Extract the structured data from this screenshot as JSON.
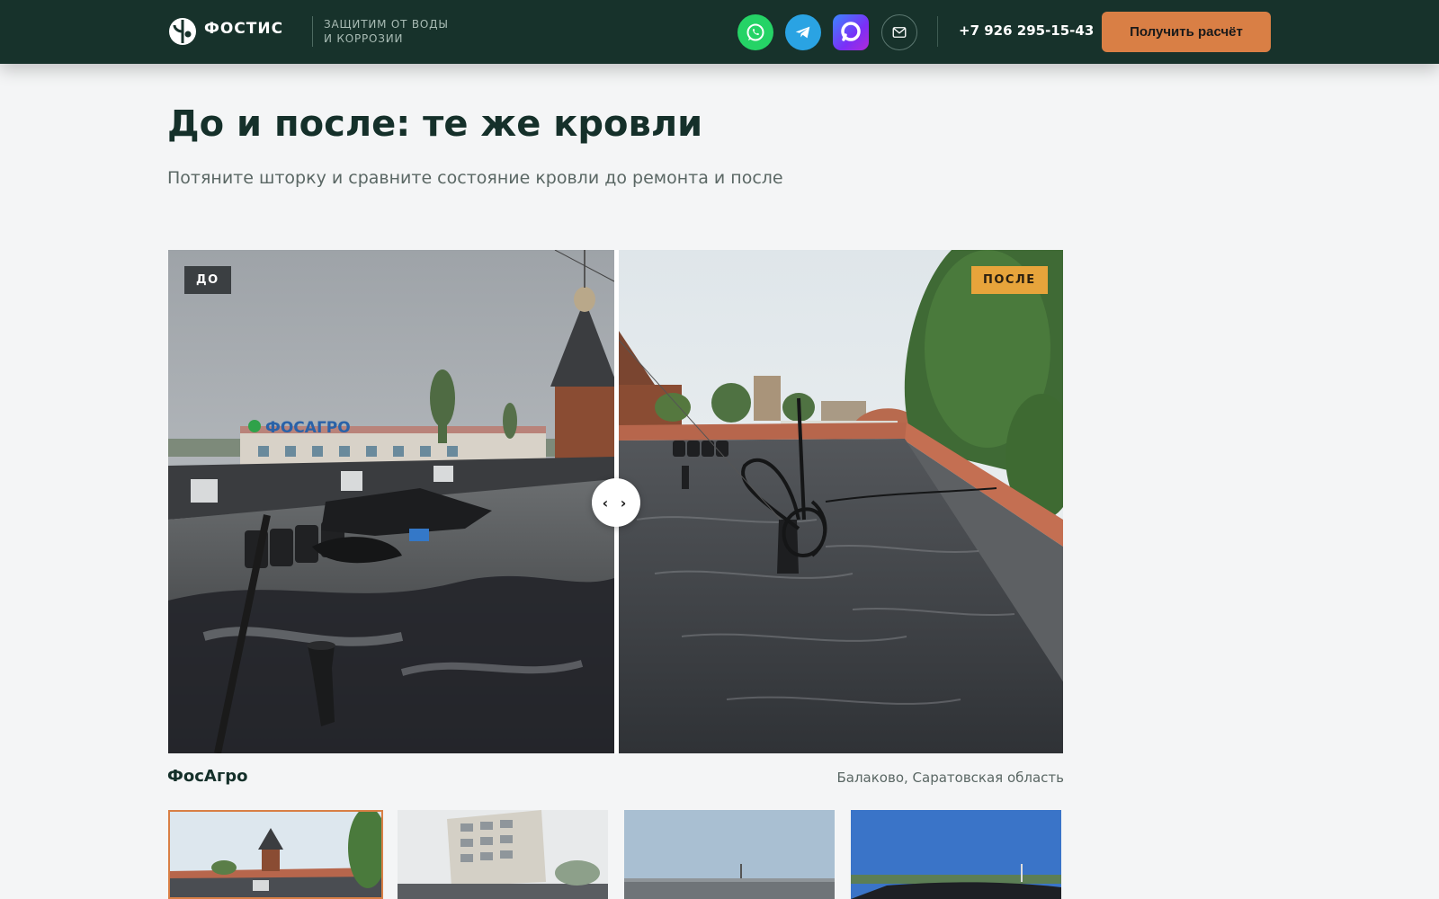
{
  "header": {
    "logo_text": "ФОСТИС",
    "tagline_line1": "ЗАЩИТИМ ОТ ВОДЫ",
    "tagline_line2": "И КОРРОЗИИ",
    "phone": "+7 926 295-15-43",
    "cta_label": "Получить расчёт",
    "icons": [
      "whatsapp-icon",
      "telegram-icon",
      "max-messenger-icon",
      "mail-icon"
    ]
  },
  "section": {
    "title": "До и после: те же кровли",
    "subtitle": "Потяните шторку и сравните состояние кровли до ремонта и после"
  },
  "compare": {
    "before_label": "ДО",
    "after_label": "ПОСЛЕ",
    "sign_text": "ФОСАГРО",
    "handle_glyph": "‹ ›",
    "position_percent": 50
  },
  "case": {
    "name": "ФосАгро",
    "location": "Балаково, Саратовская область"
  },
  "thumbnails": {
    "selected_index": 0,
    "count": 4
  },
  "colors": {
    "header_bg": "#17322b",
    "accent": "#d97f45",
    "after_badge": "#e7a43b",
    "before_badge": "#3b3f42"
  }
}
